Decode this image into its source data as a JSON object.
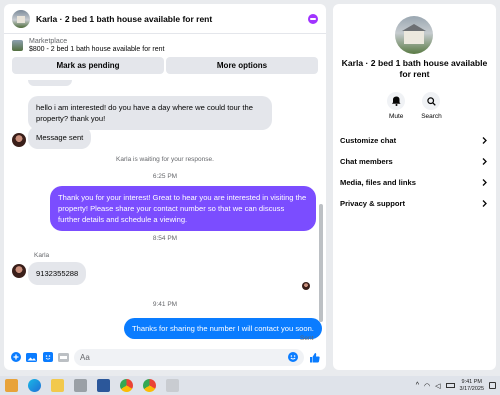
{
  "chat": {
    "title": "Karla · 2 bed 1 bath house available for rent",
    "marketplace_label": "Marketplace",
    "listing": "$800 - 2 bed 1 bath house available for rent",
    "mark_pending": "Mark as pending",
    "more_options": "More options"
  },
  "messages": {
    "incoming_1": "hello i am interested! do you have a day where we could tour the property? thank you!",
    "incoming_2": "Message sent",
    "waiting": "Karla is waiting for your response.",
    "time_1": "6:25 PM",
    "outgoing_1": "Thank you for your interest! Great to hear you are interested in visiting the property! Please share your contact number so that we can discuss further details and schedule a viewing.",
    "time_2": "8:54 PM",
    "sender": "Karla",
    "incoming_3": "9132355288",
    "time_3": "9:41 PM",
    "outgoing_2": "Thanks for sharing the number I will contact you soon.",
    "sent_status": "Sent"
  },
  "composer": {
    "placeholder": "Aa"
  },
  "info": {
    "title": "Karla · 2 bed 1 bath house available for rent",
    "mute": "Mute",
    "search": "Search",
    "menu": [
      "Customize chat",
      "Chat members",
      "Media, files and links",
      "Privacy & support"
    ]
  },
  "taskbar": {
    "time": "9:41 PM",
    "date": "3/17/2025"
  },
  "colors": {
    "accent_purple": "#7b4dff",
    "accent_blue": "#0a7cff"
  },
  "icons": [
    "plus-circle-icon",
    "photo-icon",
    "sticker-icon",
    "gif-icon",
    "emoji-icon",
    "thumbs-up-icon",
    "bell-icon",
    "search-icon",
    "chevron-right-icon"
  ]
}
